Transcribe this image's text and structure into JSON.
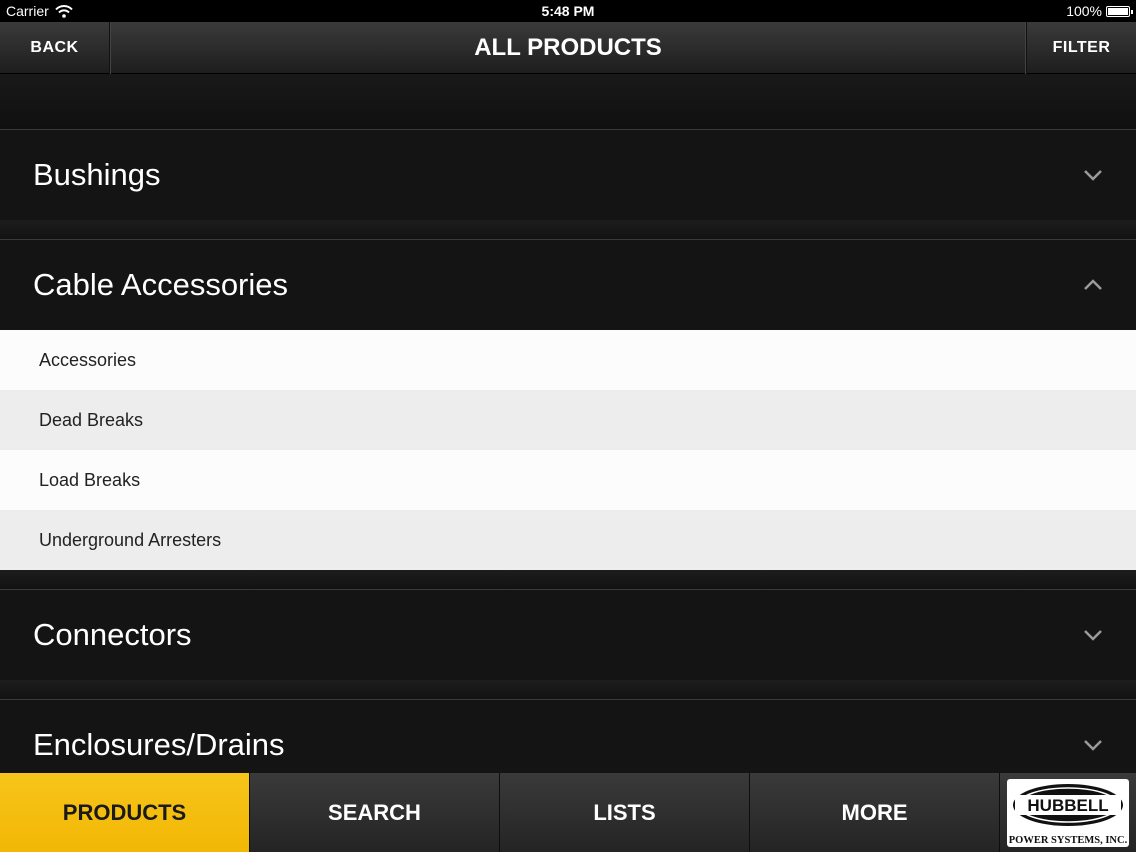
{
  "status_bar": {
    "carrier": "Carrier",
    "time": "5:48 PM",
    "battery_percent": "100%",
    "battery_level": 1.0
  },
  "nav": {
    "back_label": "BACK",
    "title": "ALL PRODUCTS",
    "filter_label": "FILTER"
  },
  "categories": [
    {
      "label": "Bushings",
      "expanded": false,
      "chevron": "chevron-down-icon"
    },
    {
      "label": "Cable Accessories",
      "expanded": true,
      "chevron": "chevron-up-icon",
      "items": [
        "Accessories",
        "Dead Breaks",
        "Load Breaks",
        "Underground Arresters"
      ]
    },
    {
      "label": "Connectors",
      "expanded": false,
      "chevron": "chevron-down-icon"
    },
    {
      "label": "Enclosures/Drains",
      "expanded": false,
      "chevron": "chevron-down-icon"
    }
  ],
  "tabs": [
    {
      "label": "PRODUCTS",
      "active": true
    },
    {
      "label": "SEARCH",
      "active": false
    },
    {
      "label": "LISTS",
      "active": false
    },
    {
      "label": "MORE",
      "active": false
    }
  ],
  "logo": {
    "brand": "HUBBELL",
    "tagline": "POWER SYSTEMS, INC."
  },
  "colors": {
    "accent": "#f7c51a",
    "background": "#151415",
    "row_light": "#fcfcfd",
    "row_alt": "#ededee"
  }
}
